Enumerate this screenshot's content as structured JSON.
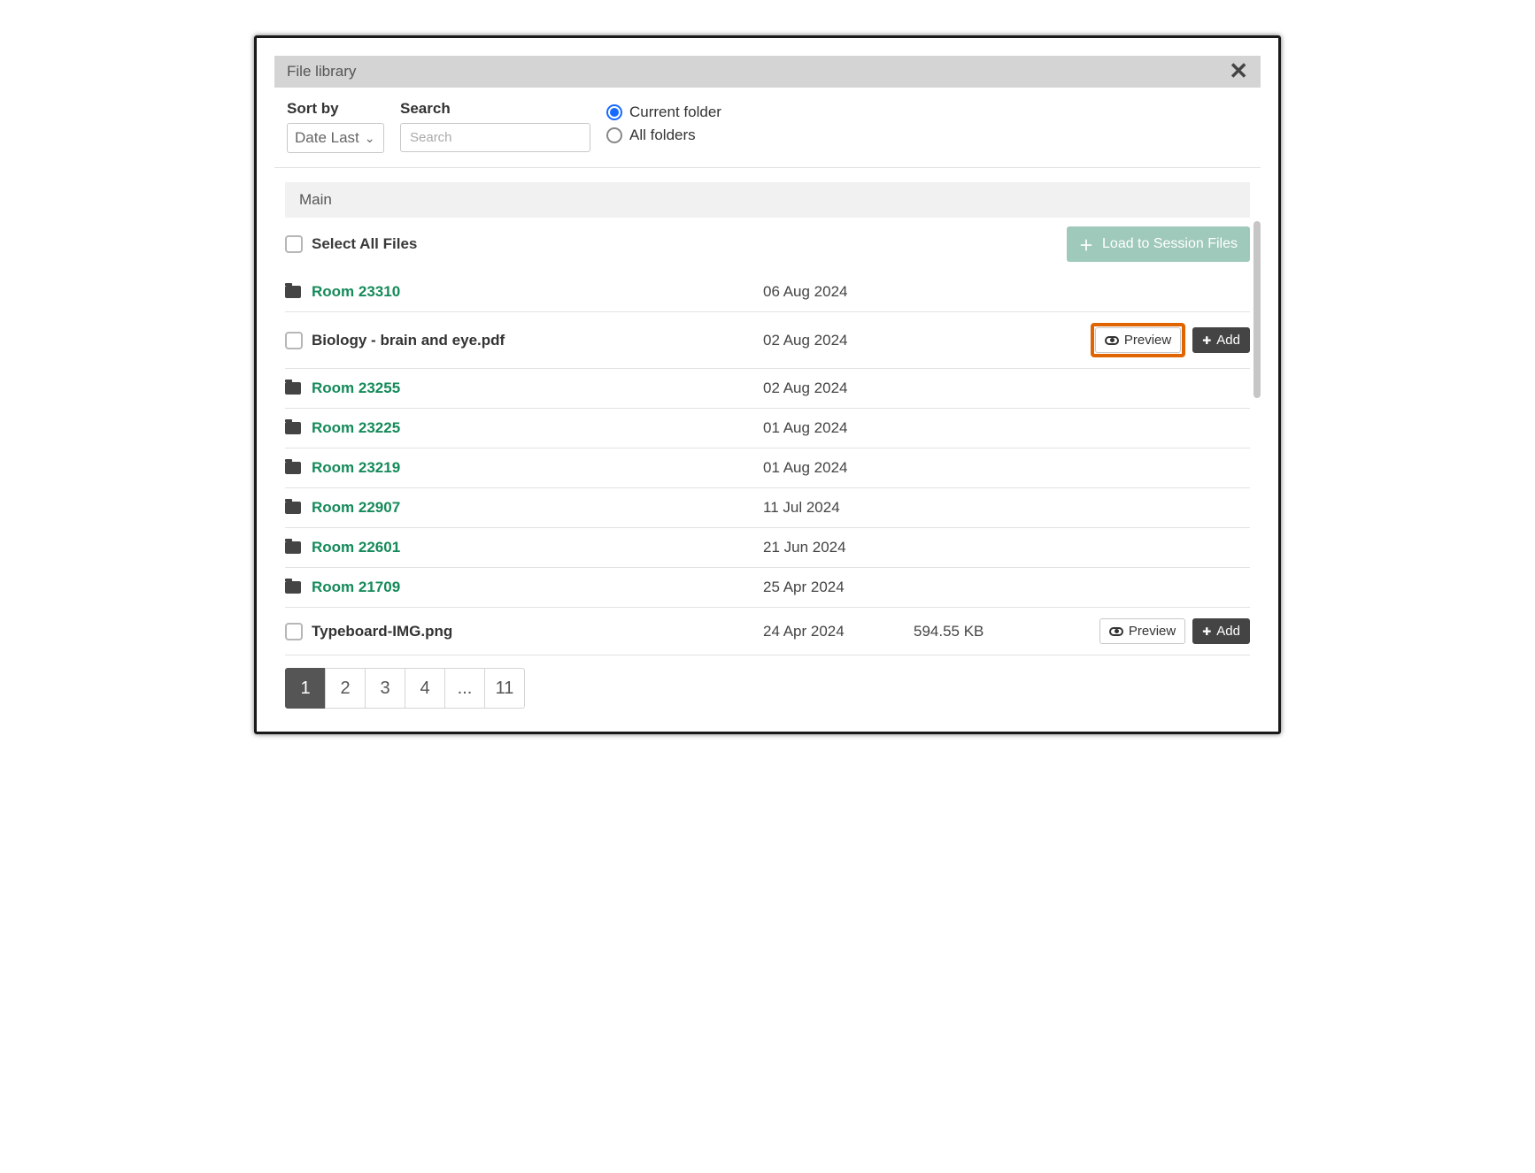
{
  "header": {
    "title": "File library"
  },
  "filters": {
    "sort_label": "Sort by",
    "sort_value": "Date Last",
    "search_label": "Search",
    "search_placeholder": "Search",
    "scope_current": "Current folder",
    "scope_all": "All folders",
    "scope_selected": "current"
  },
  "breadcrumb": "Main",
  "toolbar": {
    "select_all_label": "Select All Files",
    "load_label": "Load to Session Files"
  },
  "actions": {
    "preview": "Preview",
    "add": "Add"
  },
  "rows": [
    {
      "type": "folder",
      "name": "Room 23310",
      "date": "06 Aug 2024",
      "size": ""
    },
    {
      "type": "file",
      "name": "Biology - brain and eye.pdf",
      "date": "02 Aug 2024",
      "size": "",
      "highlight_preview": true
    },
    {
      "type": "folder",
      "name": "Room 23255",
      "date": "02 Aug 2024",
      "size": ""
    },
    {
      "type": "folder",
      "name": "Room 23225",
      "date": "01 Aug 2024",
      "size": ""
    },
    {
      "type": "folder",
      "name": "Room 23219",
      "date": "01 Aug 2024",
      "size": ""
    },
    {
      "type": "folder",
      "name": "Room 22907",
      "date": "11 Jul 2024",
      "size": ""
    },
    {
      "type": "folder",
      "name": "Room 22601",
      "date": "21 Jun 2024",
      "size": ""
    },
    {
      "type": "folder",
      "name": "Room 21709",
      "date": "25 Apr 2024",
      "size": ""
    },
    {
      "type": "file",
      "name": "Typeboard-IMG.png",
      "date": "24 Apr 2024",
      "size": "594.55 KB"
    }
  ],
  "pagination": {
    "pages": [
      "1",
      "2",
      "3",
      "4",
      "...",
      "11"
    ],
    "active": "1"
  }
}
